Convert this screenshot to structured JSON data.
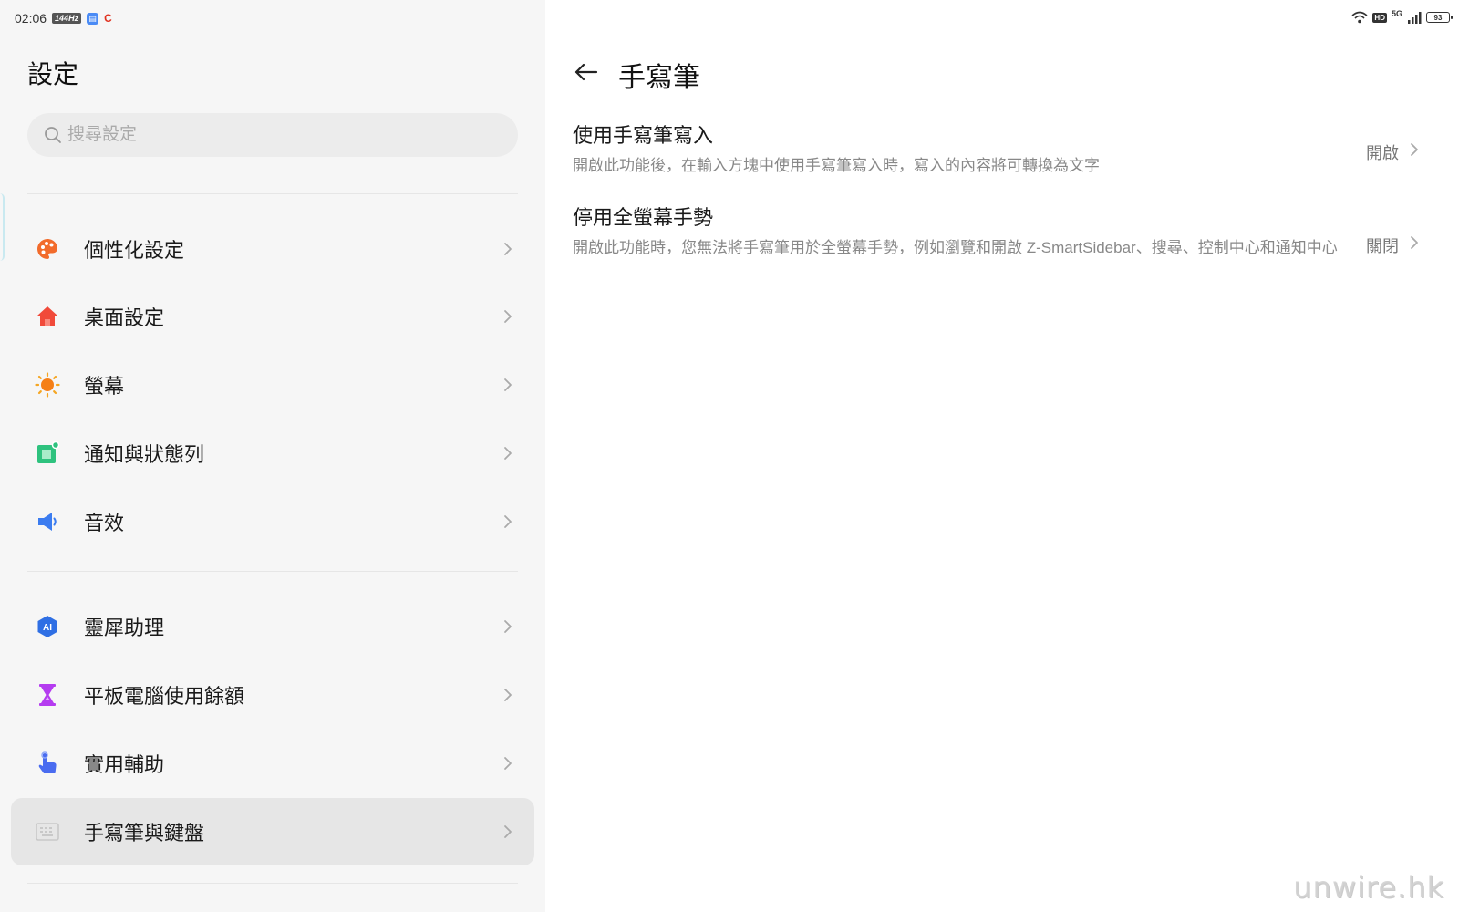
{
  "status_bar": {
    "time": "02:06",
    "badge": "144Hz",
    "network": "5G",
    "hd": "HD",
    "battery": "93"
  },
  "left": {
    "title": "設定",
    "search_placeholder": "搜尋設定",
    "items": [
      {
        "label": "個性化設定",
        "icon": "palette-icon",
        "color": "#f26b2b"
      },
      {
        "label": "桌面設定",
        "icon": "home-icon",
        "color": "#f14a3a"
      },
      {
        "label": "螢幕",
        "icon": "sun-icon",
        "color": "#f57f17"
      },
      {
        "label": "通知與狀態列",
        "icon": "notification-icon",
        "color": "#2ec27e"
      },
      {
        "label": "音效",
        "icon": "speaker-icon",
        "color": "#3b7cf0"
      },
      {
        "label": "靈犀助理",
        "icon": "ai-assistant-icon",
        "color": "#2f6fe4"
      },
      {
        "label": "平板電腦使用餘額",
        "icon": "hourglass-icon",
        "color": "#b53cf0"
      },
      {
        "label": "實用輔助",
        "icon": "hand-pointer-icon",
        "color": "#4a6cf0"
      },
      {
        "label": "手寫筆與鍵盤",
        "icon": "keyboard-icon",
        "color": "#c8c8c8",
        "active": true
      }
    ]
  },
  "right": {
    "title": "手寫筆",
    "prefs": [
      {
        "title": "使用手寫筆寫入",
        "desc": "開啟此功能後，在輸入方塊中使用手寫筆寫入時，寫入的內容將可轉換為文字",
        "value": "開啟"
      },
      {
        "title": "停用全螢幕手勢",
        "desc": "開啟此功能時，您無法將手寫筆用於全螢幕手勢，例如瀏覽和開啟 Z-SmartSidebar、搜尋、控制中心和通知中心",
        "value": "關閉"
      }
    ]
  },
  "watermark": "unwire.hk"
}
